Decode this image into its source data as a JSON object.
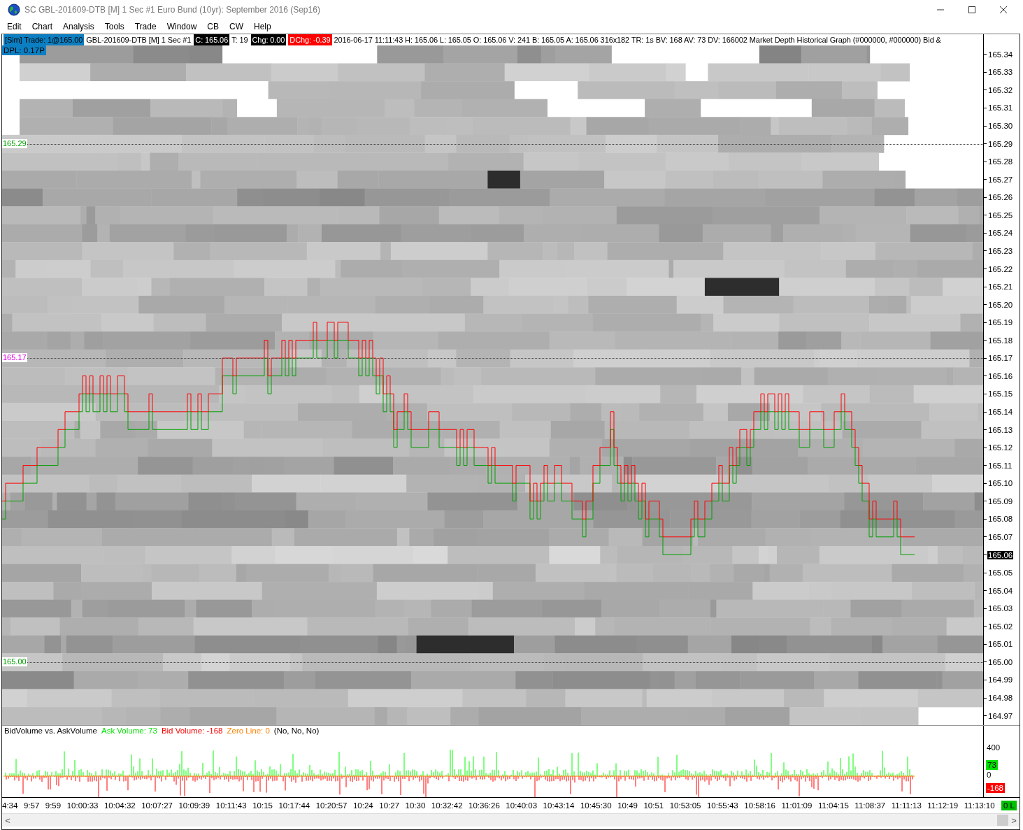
{
  "window": {
    "title": "SC GBL-201609-DTB [M]  1 Sec   #1  Euro Bund (10yr): September 2016 (Sep16)"
  },
  "menu": [
    "Edit",
    "Chart",
    "Analysis",
    "Tools",
    "Trade",
    "Window",
    "CB",
    "CW",
    "Help"
  ],
  "info_bar": [
    {
      "text": "[Sim]  Trade: 1@165.00",
      "kind": "highlight"
    },
    {
      "text": "GBL-201609-DTB [M]  1 Sec   #1",
      "kind": "plain"
    },
    {
      "text": "C: 165.06",
      "kind": "dark"
    },
    {
      "text": "T: 19",
      "kind": "plain"
    },
    {
      "text": "Chg: 0.00",
      "kind": "dark"
    },
    {
      "text": "DChg: -0.39",
      "kind": "alert"
    },
    {
      "text": "2016-06-17 11:11:43 H: 165.06 L: 165.05 O: 165.06 V: 241 B: 165.05 A: 165.06 316x182 TR: 1s BV: 168 AV: 73 DV: 166002  Market Depth Historical Graph   (#000000, #000000)  Bid &",
      "kind": "plain"
    }
  ],
  "dpl": "DPL: 0.17P",
  "price_axis": [
    {
      "label": "165.34",
      "selected": false
    },
    {
      "label": "165.33",
      "selected": false
    },
    {
      "label": "165.32",
      "selected": false
    },
    {
      "label": "165.31",
      "selected": false
    },
    {
      "label": "165.30",
      "selected": false
    },
    {
      "label": "165.29",
      "selected": false,
      "line_marker": {
        "text": "165.29",
        "color": "#00a000"
      }
    },
    {
      "label": "165.28",
      "selected": false
    },
    {
      "label": "165.27",
      "selected": false
    },
    {
      "label": "165.26",
      "selected": false
    },
    {
      "label": "165.25",
      "selected": false
    },
    {
      "label": "165.24",
      "selected": false
    },
    {
      "label": "165.23",
      "selected": false
    },
    {
      "label": "165.22",
      "selected": false
    },
    {
      "label": "165.21",
      "selected": false
    },
    {
      "label": "165.20",
      "selected": false
    },
    {
      "label": "165.19",
      "selected": false
    },
    {
      "label": "165.18",
      "selected": false
    },
    {
      "label": "165.17",
      "selected": false,
      "line_marker": {
        "text": "165.17",
        "color": "#e000e0"
      }
    },
    {
      "label": "165.16",
      "selected": false
    },
    {
      "label": "165.15",
      "selected": false
    },
    {
      "label": "165.14",
      "selected": false
    },
    {
      "label": "165.13",
      "selected": false
    },
    {
      "label": "165.12",
      "selected": false
    },
    {
      "label": "165.11",
      "selected": false
    },
    {
      "label": "165.10",
      "selected": false
    },
    {
      "label": "165.09",
      "selected": false
    },
    {
      "label": "165.08",
      "selected": false
    },
    {
      "label": "165.07",
      "selected": false
    },
    {
      "label": "165.06",
      "selected": true
    },
    {
      "label": "165.05",
      "selected": false
    },
    {
      "label": "165.04",
      "selected": false
    },
    {
      "label": "165.03",
      "selected": false
    },
    {
      "label": "165.02",
      "selected": false
    },
    {
      "label": "165.01",
      "selected": false
    },
    {
      "label": "165.00",
      "selected": false,
      "line_marker": {
        "text": "165.00",
        "color": "#00a000"
      }
    },
    {
      "label": "164.99",
      "selected": false
    },
    {
      "label": "164.98",
      "selected": false
    },
    {
      "label": "164.97",
      "selected": false
    }
  ],
  "volume_header": [
    {
      "text": "BidVolume vs. AskVolume"
    },
    {
      "text": "Ask Volume: 73",
      "color": "#00e000"
    },
    {
      "text": "Bid Volume: -168",
      "color": "#ff0000"
    },
    {
      "text": "Zero Line: 0",
      "color": "#ff8000"
    },
    {
      "text": "(No, No, No)"
    }
  ],
  "volume_axis": [
    "400",
    "0"
  ],
  "volume_badges": [
    {
      "text": "73",
      "color": "#00e000"
    },
    {
      "text": "-168",
      "color": "#ff0000"
    }
  ],
  "time_axis": [
    "4:34",
    "9:57",
    "9:59",
    "10:00:33",
    "10:04:32",
    "10:07:27",
    "10:09:39",
    "10:11:43",
    "10:15",
    "10:17:44",
    "10:20:57",
    "10:24",
    "10:27",
    "10:30",
    "10:32:42",
    "10:36:26",
    "10:40:03",
    "10:43:14",
    "10:45:30",
    "10:49",
    "10:51",
    "10:53:05",
    "10:55:43",
    "10:58:16",
    "11:01:09",
    "11:04:15",
    "11:08:37",
    "11:11:13",
    "11:12:19",
    "11:13:10"
  ],
  "status": "0 L",
  "scroll_left": "<",
  "scroll_right": ">"
}
